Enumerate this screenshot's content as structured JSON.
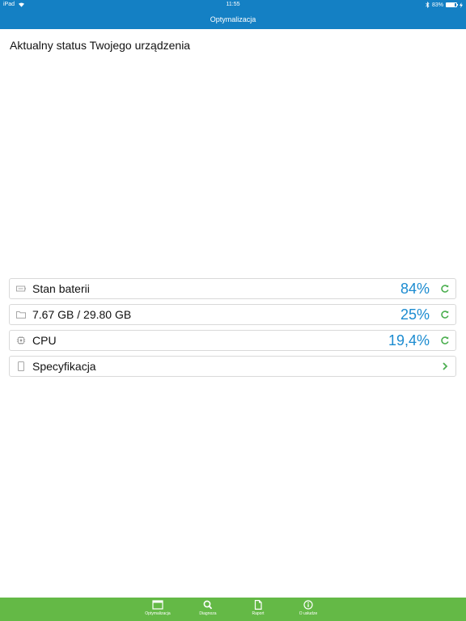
{
  "status_bar": {
    "device": "iPad",
    "time": "11:55",
    "battery_percent": "83%",
    "battery_level": 0.83
  },
  "nav": {
    "title": "Optymalizacja"
  },
  "main": {
    "heading": "Aktualny status Twojego urządzenia",
    "rows": [
      {
        "label": "Stan baterii",
        "value": "84%",
        "icon": "battery-icon",
        "action_icon": "refresh-icon"
      },
      {
        "label": "7.67 GB / 29.80 GB",
        "value": "25%",
        "icon": "folder-icon",
        "action_icon": "refresh-icon"
      },
      {
        "label": "CPU",
        "value": "19,4%",
        "icon": "cpu-icon",
        "action_icon": "refresh-icon"
      },
      {
        "label": "Specyfikacja",
        "value": "",
        "icon": "device-icon",
        "action_icon": "chevron-right-icon"
      }
    ]
  },
  "tabs": [
    {
      "label": "Optymalizacja",
      "icon": "window-icon"
    },
    {
      "label": "Diagnoza",
      "icon": "search-icon"
    },
    {
      "label": "Raport",
      "icon": "document-icon"
    },
    {
      "label": "O usłudze",
      "icon": "info-icon"
    }
  ],
  "colors": {
    "header": "#1480c4",
    "tabbar": "#64b946",
    "value_text": "#1b8bd0",
    "accent_green": "#4caf50"
  }
}
